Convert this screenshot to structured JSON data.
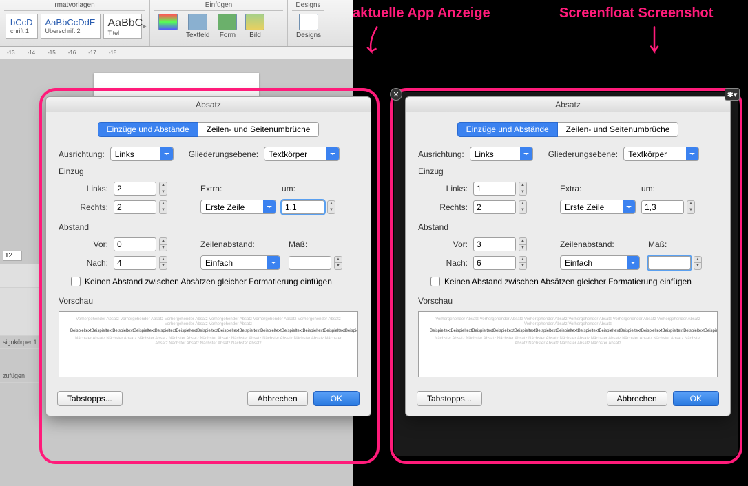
{
  "annotations": {
    "left_label": "aktuelle App Anzeige",
    "right_label": "Screenfloat Screenshot"
  },
  "ribbon": {
    "section1_label": "rmatvorlagen",
    "section2_label": "Einfügen",
    "section3_label": "Designs",
    "style1_sample": "bCcD",
    "style1_name": "chrift 1",
    "style2_sample": "AaBbCcDdE",
    "style2_name": "Überschrift 2",
    "style3_sample": "AaBbC",
    "style3_name": "Titel",
    "btn_textfeld": "Textfeld",
    "btn_form": "Form",
    "btn_bild": "Bild",
    "btn_designs": "Designs"
  },
  "ruler": [
    "-13",
    "-14",
    "-15",
    "-16",
    "-17",
    "-18"
  ],
  "sidebar": {
    "fontsize": "12",
    "style_name": "signkörper 1",
    "link": "zufügen"
  },
  "dialog": {
    "title": "Absatz",
    "tab1": "Einzüge und Abstände",
    "tab2": "Zeilen- und Seitenumbrüche",
    "ausrichtung_lbl": "Ausrichtung:",
    "ausrichtung_val": "Links",
    "gliederung_lbl": "Gliederungsebene:",
    "gliederung_val": "Textkörper",
    "einzug_lbl": "Einzug",
    "links_lbl": "Links:",
    "rechts_lbl": "Rechts:",
    "extra_lbl": "Extra:",
    "extra_val": "Erste Zeile",
    "um_lbl": "um:",
    "abstand_lbl": "Abstand",
    "vor_lbl": "Vor:",
    "nach_lbl": "Nach:",
    "zeilenabstand_lbl": "Zeilenabstand:",
    "zeilenabstand_val": "Einfach",
    "mass_lbl": "Maß:",
    "checkbox_lbl": "Keinen Abstand zwischen Absätzen gleicher Formatierung einfügen",
    "vorschau_lbl": "Vorschau",
    "tabstops_btn": "Tabstopps...",
    "cancel_btn": "Abbrechen",
    "ok_btn": "OK",
    "close_glyph": "✕",
    "gear_glyph": "✱▾"
  },
  "left": {
    "links": "2",
    "rechts": "2",
    "um": "1,1",
    "vor": "0",
    "nach": "4",
    "mass": ""
  },
  "right": {
    "links": "1",
    "rechts": "2",
    "um": "1,3",
    "vor": "3",
    "nach": "6",
    "mass": ""
  },
  "preview": {
    "before": "Vorhergehender Absatz Vorhergehender Absatz Vorhergehender Absatz Vorhergehender Absatz Vorhergehender Absatz Vorhergehender Absatz Vorhergehender Absatz Vorhergehender Absatz",
    "mid": "BeispieltextBeispieltextBeispieltextBeispieltextBeispieltextBeispieltextBeispieltextBeispieltextBeispieltextBeispieltextBeispieltextBeispieltextBeispieltextBeispieltextBeispieltext",
    "after": "Nächster Absatz Nächster Absatz Nächster Absatz Nächster Absatz Nächster Absatz Nächster Absatz Nächster Absatz Nächster Absatz Nächster Absatz Nächster Absatz Nächster Absatz Nächster Absatz"
  }
}
